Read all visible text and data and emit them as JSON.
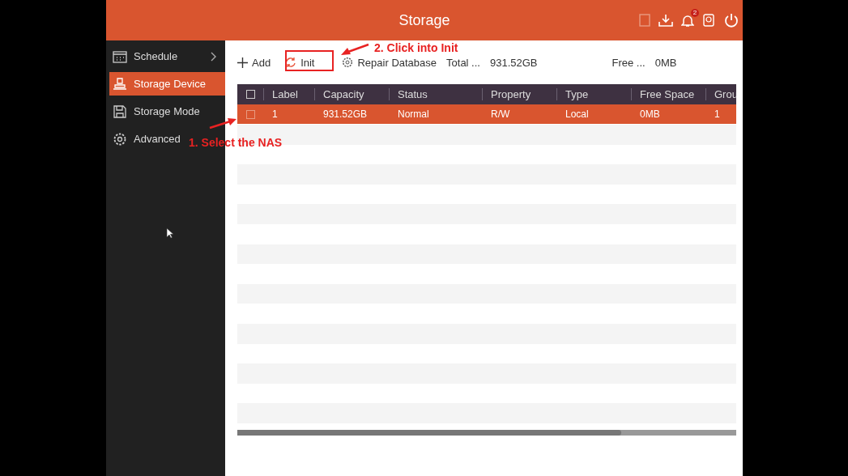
{
  "header": {
    "title": "Storage",
    "alarm_count": "2"
  },
  "sidebar": {
    "items": [
      {
        "label": "Schedule",
        "kind": "calendar",
        "selected": false,
        "has_submenu": true
      },
      {
        "label": "Storage Device",
        "kind": "device",
        "selected": true,
        "has_submenu": false
      },
      {
        "label": "Storage Mode",
        "kind": "disk",
        "selected": false,
        "has_submenu": false
      },
      {
        "label": "Advanced",
        "kind": "gear",
        "selected": false,
        "has_submenu": false
      }
    ]
  },
  "toolbar": {
    "buttons": [
      {
        "label": "Add",
        "kind": "plus"
      },
      {
        "label": "Init",
        "kind": "refresh"
      },
      {
        "label": "Repair Database",
        "kind": "gear"
      }
    ],
    "total_label": "Total ...",
    "total_value": "931.52GB",
    "free_label": "Free ...",
    "free_value": "0MB"
  },
  "table": {
    "all_checked": false,
    "columns": [
      "Label",
      "Capacity",
      "Status",
      "Property",
      "Type",
      "Free Space",
      "Grou"
    ],
    "rows": [
      {
        "cells": [
          "1",
          "931.52GB",
          "Normal",
          "R/W",
          "Local",
          "0MB",
          "1"
        ],
        "selected": true,
        "checked": false
      }
    ]
  },
  "annotations": [
    {
      "text": "1. Select the NAS"
    },
    {
      "text": "2. Click into Init"
    }
  ]
}
